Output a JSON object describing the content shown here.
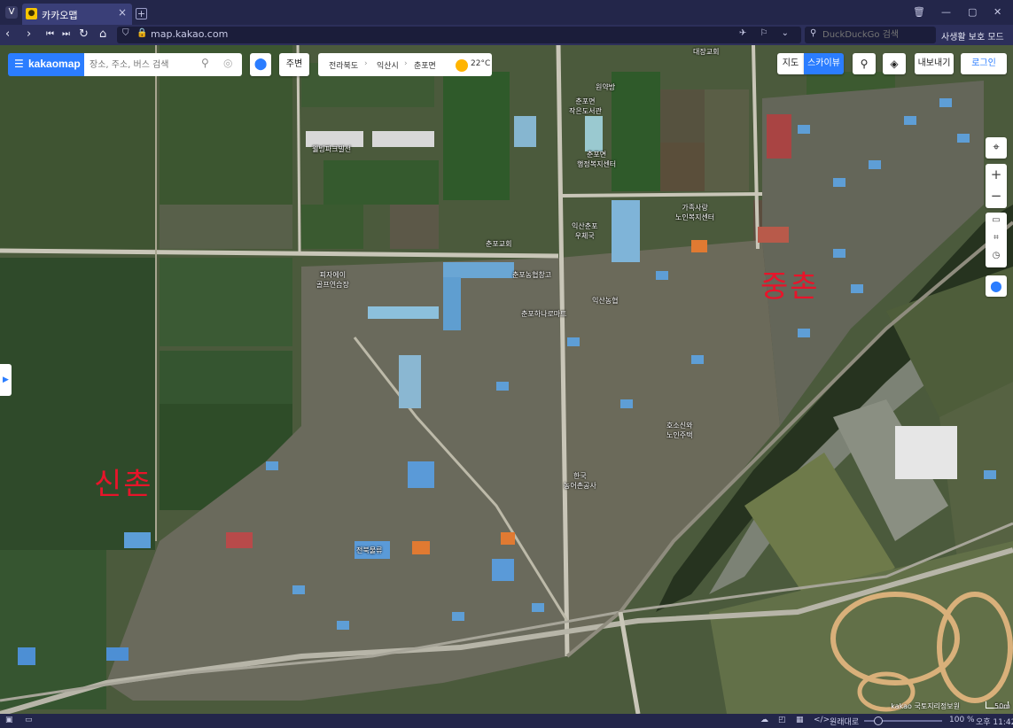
{
  "browser": {
    "tab_title": "카카오맵",
    "url": "map.kakao.com",
    "search_placeholder": "DuckDuckGo 검색",
    "private_mode": "사생활 보호 모드"
  },
  "kakao": {
    "logo": "kakaomap",
    "search_placeholder": "장소, 주소, 버스 검색",
    "nearby_label": "주변",
    "breadcrumb": [
      "전라북도",
      "익산시",
      "춘포면"
    ],
    "temperature": "22°C",
    "map_type_map": "지도",
    "map_type_skyview": "스카이뷰",
    "export_label": "내보내기",
    "login_label": "로그인"
  },
  "regions": {
    "left": "신촌",
    "right": "중촌"
  },
  "map_labels": {
    "church_top": "대장교회",
    "pharmacy": "원약방",
    "library": "춘포면\n작은도서관",
    "welfare": "춘포면\n행정복지센터",
    "village_house": "웰빙파크빌선",
    "family_welfare": "가족사랑\n노인복지센터",
    "postoffice": "익산춘포\n우체국",
    "chunpo_church": "춘포교회",
    "pizza": "피자에이\n골프연습장",
    "nonghyup_warehouse": "춘포농협창고",
    "nonghyup": "익산농협",
    "hanaro": "춘포하나로마트",
    "hoso": "호소신와\n노인주택",
    "rural": "한국\n농어촌공사",
    "jeonbuk": "전북물류",
    "copyright": "kakao 국토지리정보원",
    "scale": "50m"
  },
  "statusbar": {
    "zoom_reset": "원래대로",
    "zoom": "100 %",
    "time": "오후 11:42"
  }
}
